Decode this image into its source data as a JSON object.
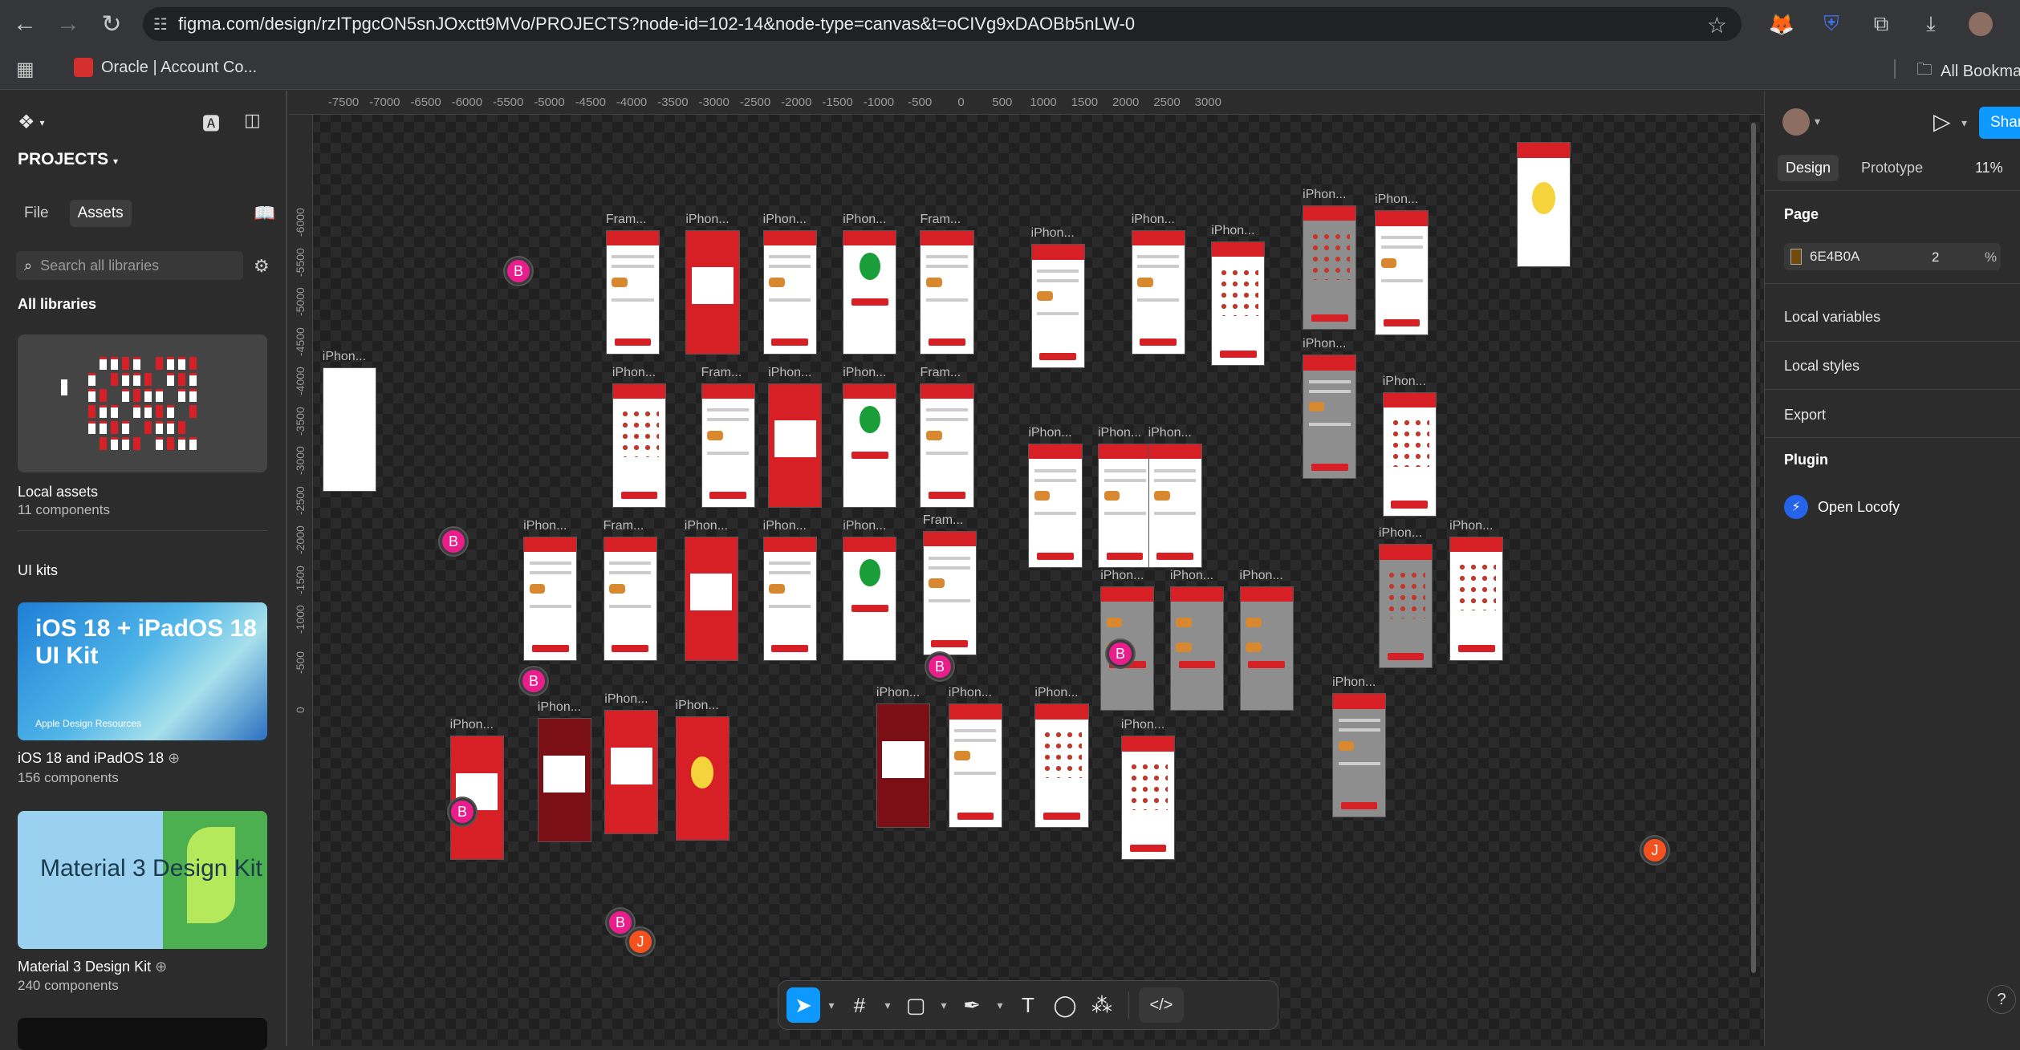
{
  "browser": {
    "url": "figma.com/design/rzITpgcON5snJOxctt9MVo/PROJECTS?node-id=102-14&node-type=canvas&t=oCIVg9xDAOBb5nLW-0",
    "bookmark": "Oracle | Account Co...",
    "bookmarks_all": "All Bookmarks"
  },
  "left_panel": {
    "file_title": "PROJECTS",
    "tabs": [
      "File",
      "Assets"
    ],
    "active_tab": "Assets",
    "search_placeholder": "Search all libraries",
    "all_libraries": "All libraries",
    "local_assets": {
      "name": "Local assets",
      "count": "11 components"
    },
    "ui_kits_label": "UI kits",
    "kits": [
      {
        "name": "iOS 18 and iPadOS 18",
        "count": "156 components",
        "preview_title": "iOS 18 + iPadOS 18 UI Kit",
        "preview_footer": "Apple Design Resources"
      },
      {
        "name": "Material 3 Design Kit",
        "count": "240 components",
        "preview_title": "Material 3 Design Kit"
      }
    ]
  },
  "canvas": {
    "ruler_x": [
      "-7500",
      "-7000",
      "-6500",
      "-6000",
      "-5500",
      "-5000",
      "-4500",
      "-4000",
      "-3500",
      "-3000",
      "-2500",
      "-2000",
      "-1500",
      "-1000",
      "-500",
      "0",
      "500",
      "1000",
      "1500",
      "2000",
      "2500",
      "3000"
    ],
    "ruler_y": [
      "-6000",
      "-5500",
      "-5000",
      "-4500",
      "-4000",
      "-3500",
      "-3000",
      "-2500",
      "-2000",
      "-1500",
      "-1000",
      "-500",
      "0"
    ],
    "frames": [
      {
        "label": "",
        "style": "white-emoji"
      },
      {
        "label": "Fram...",
        "style": "white"
      },
      {
        "label": "iPhon...",
        "style": "red"
      },
      {
        "label": "iPhon...",
        "style": "white"
      },
      {
        "label": "iPhon...",
        "style": "white-check"
      },
      {
        "label": "Fram...",
        "style": "white"
      },
      {
        "label": "iPhon...",
        "style": "white"
      },
      {
        "label": "iPhon...",
        "style": "white"
      },
      {
        "label": "iPhon...",
        "style": "white-grid"
      },
      {
        "label": "iPhon...",
        "style": "gray-grid"
      },
      {
        "label": "iPhon...",
        "style": "white"
      },
      {
        "label": "iPhon...",
        "style": "white-blank"
      },
      {
        "label": "iPhon...",
        "style": "white-grid"
      },
      {
        "label": "Fram...",
        "style": "white"
      },
      {
        "label": "iPhon...",
        "style": "red"
      },
      {
        "label": "iPhon...",
        "style": "white-check"
      },
      {
        "label": "Fram...",
        "style": "white"
      },
      {
        "label": "iPhon...",
        "style": "gray"
      },
      {
        "label": "iPhon...",
        "style": "white-grid"
      },
      {
        "label": "iPhon...",
        "style": "white"
      },
      {
        "label": "iPhon...",
        "style": "white"
      },
      {
        "label": "iPhon...",
        "style": "white"
      },
      {
        "label": "iPhon...",
        "style": "white"
      },
      {
        "label": "Fram...",
        "style": "white"
      },
      {
        "label": "iPhon...",
        "style": "red"
      },
      {
        "label": "iPhon...",
        "style": "white"
      },
      {
        "label": "iPhon...",
        "style": "white-check"
      },
      {
        "label": "Fram...",
        "style": "white"
      },
      {
        "label": "iPhon...",
        "style": "gray-food"
      },
      {
        "label": "iPhon...",
        "style": "gray-food"
      },
      {
        "label": "iPhon...",
        "style": "gray-food"
      },
      {
        "label": "iPhon...",
        "style": "gray-grid"
      },
      {
        "label": "iPhon...",
        "style": "white-grid"
      },
      {
        "label": "iPhon...",
        "style": "red"
      },
      {
        "label": "iPhon...",
        "style": "darkred"
      },
      {
        "label": "iPhon...",
        "style": "red"
      },
      {
        "label": "iPhon...",
        "style": "red-emoji"
      },
      {
        "label": "iPhon...",
        "style": "darkred"
      },
      {
        "label": "iPhon...",
        "style": "white"
      },
      {
        "label": "iPhon...",
        "style": "white-grid"
      },
      {
        "label": "iPhon...",
        "style": "white-grid"
      },
      {
        "label": "iPhon...",
        "style": "gray"
      }
    ],
    "collaborators": [
      "B",
      "B",
      "B",
      "B",
      "B",
      "B",
      "J",
      "B",
      "J"
    ]
  },
  "toolbar": {
    "tools": [
      "move-tool",
      "frame-tool",
      "shape-tool",
      "pen-tool",
      "text-tool",
      "comment-tool",
      "actions-tool",
      "dev-mode-toggle"
    ]
  },
  "right_panel": {
    "share_label": "Share",
    "tabs": [
      "Design",
      "Prototype"
    ],
    "active_tab": "Design",
    "zoom": "11%",
    "page_label": "Page",
    "page_color": "6E4B0A",
    "page_opacity": "2",
    "page_opacity_unit": "%",
    "sections": [
      "Local variables",
      "Local styles",
      "Export"
    ],
    "plugin_label": "Plugin",
    "plugin_name": "Open Locofy"
  },
  "colors": {
    "accent": "#0d99ff",
    "collab_b": "#e91e8c",
    "collab_j": "#f4511e",
    "brand_red": "#d71f26"
  }
}
